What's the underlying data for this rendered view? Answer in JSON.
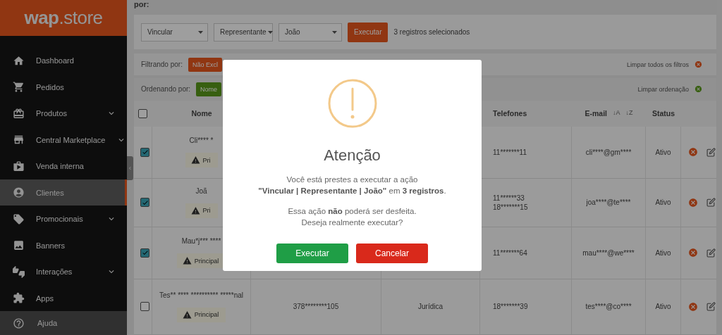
{
  "sidebar": {
    "logo": {
      "bold": "wap",
      "light": ".store"
    },
    "items": [
      {
        "label": "Dashboard",
        "selected": false,
        "expandable": false
      },
      {
        "label": "Pedidos",
        "selected": false,
        "expandable": false
      },
      {
        "label": "Produtos",
        "selected": false,
        "expandable": true
      },
      {
        "label": "Central Marketplace",
        "selected": false,
        "expandable": true
      },
      {
        "label": "Venda interna",
        "selected": false,
        "expandable": false
      },
      {
        "label": "Clientes",
        "selected": true,
        "expandable": false
      },
      {
        "label": "Promocionais",
        "selected": false,
        "expandable": true
      },
      {
        "label": "Banners",
        "selected": false,
        "expandable": false
      },
      {
        "label": "Interações",
        "selected": false,
        "expandable": true
      },
      {
        "label": "Apps",
        "selected": false,
        "expandable": false
      }
    ],
    "help": {
      "label": "Ajuda"
    }
  },
  "page": {
    "heading": "por:"
  },
  "bulk_actions": {
    "selects": [
      "Vincular",
      "Representante",
      "João"
    ],
    "button": "Executar",
    "selection_count": "3 registros selecionados"
  },
  "filters": {
    "label": "Filtrando por:",
    "chips": [
      "Não Excl"
    ],
    "clear": "Limpar todos os filtros"
  },
  "sorting": {
    "label": "Ordenando por:",
    "chips": [
      "Nome"
    ],
    "clear": "Limpar ordenação"
  },
  "table": {
    "select_all": {
      "checked": false
    },
    "columns": [
      {
        "label": "Nome",
        "kind": "name"
      },
      {
        "label": "Telefones",
        "kind": "phones"
      },
      {
        "label": "E-mail",
        "kind": "email",
        "sort": [
          "↓A",
          "↓Z"
        ]
      },
      {
        "label": "Status",
        "kind": "status"
      }
    ],
    "rows": [
      {
        "checked": true,
        "name": "Cli**** *",
        "badge": "Pri",
        "phones": [
          "11*******11"
        ],
        "email": "cli****@gm****",
        "status": "Ativo"
      },
      {
        "checked": true,
        "name": "Joã",
        "badge": "Pri",
        "phones": [
          "11******33",
          "18*******15"
        ],
        "email": "joa****@te****",
        "status": "Ativo"
      },
      {
        "checked": true,
        "name": "Mau*j*** ****",
        "badge": "Principal",
        "phones": [
          "11*******64"
        ],
        "email": "mau****@we****",
        "status": "Ativo"
      },
      {
        "checked": false,
        "name": "Tes** **** ********** *****nal",
        "badge": "Principal",
        "document": "378********105",
        "type": "Jurídica",
        "phones": [
          "18*******39"
        ],
        "email": "tes****@co****",
        "status": "Ativo"
      }
    ]
  },
  "dialog": {
    "title": "Atenção",
    "message": "Você está prestes a executar a ação\n**\"Vincular | Representante | João\"** em **3 registros**.",
    "warning": "Essa ação **não** poderá ser desfeita.\nDeseja realmente executar?",
    "buttons": [
      {
        "label": "Executar",
        "kind": "confirm"
      },
      {
        "label": "Cancelar",
        "kind": "cancel"
      }
    ]
  }
}
